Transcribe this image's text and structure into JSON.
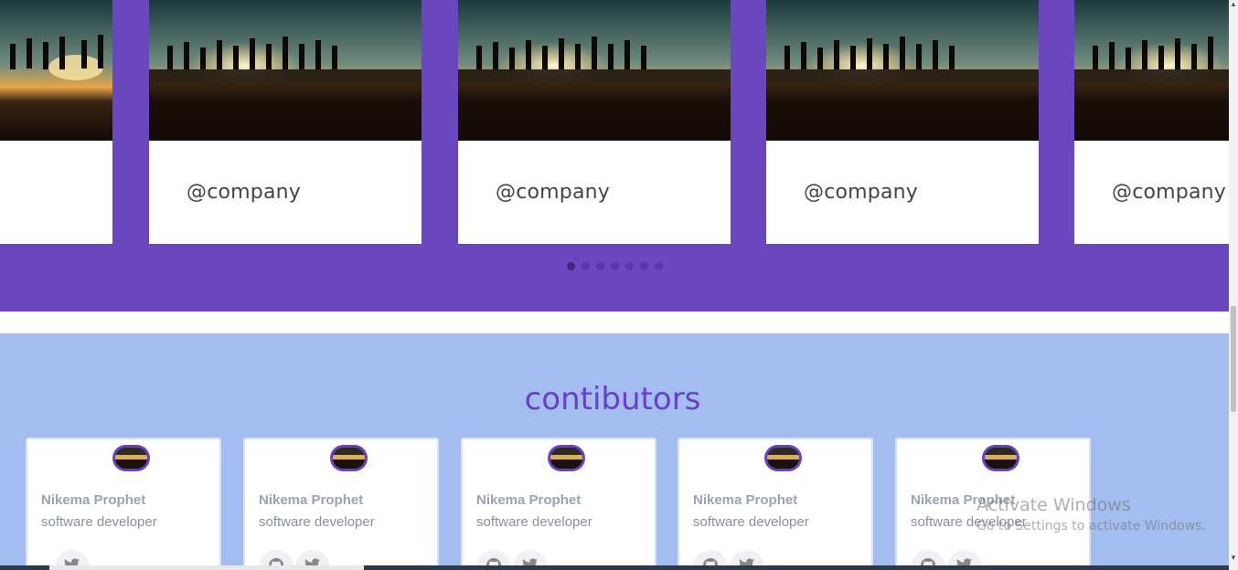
{
  "carousel": {
    "cards": [
      {
        "company": ""
      },
      {
        "company": "@company"
      },
      {
        "company": "@company"
      },
      {
        "company": "@company"
      },
      {
        "company": "@company"
      }
    ],
    "dots_count": 7,
    "active_dot": 0
  },
  "contributors": {
    "title": "contibutors",
    "people": [
      {
        "name": "Nikema Prophet",
        "role": "software developer"
      },
      {
        "name": "Nikema Prophet",
        "role": "software developer"
      },
      {
        "name": "Nikema Prophet",
        "role": "software developer"
      },
      {
        "name": "Nikema Prophet",
        "role": "software developer"
      },
      {
        "name": "Nikema Prophet",
        "role": "software developer"
      }
    ]
  },
  "watermark": {
    "title": "Activate Windows",
    "subtitle": "Go to Settings to activate Windows."
  },
  "colors": {
    "carousel_bg": "#6b46c1",
    "contrib_bg": "#a4bdf0",
    "accent": "#6a3fc8"
  },
  "icons": {
    "social_github": "github-icon",
    "social_twitter": "twitter-icon"
  }
}
